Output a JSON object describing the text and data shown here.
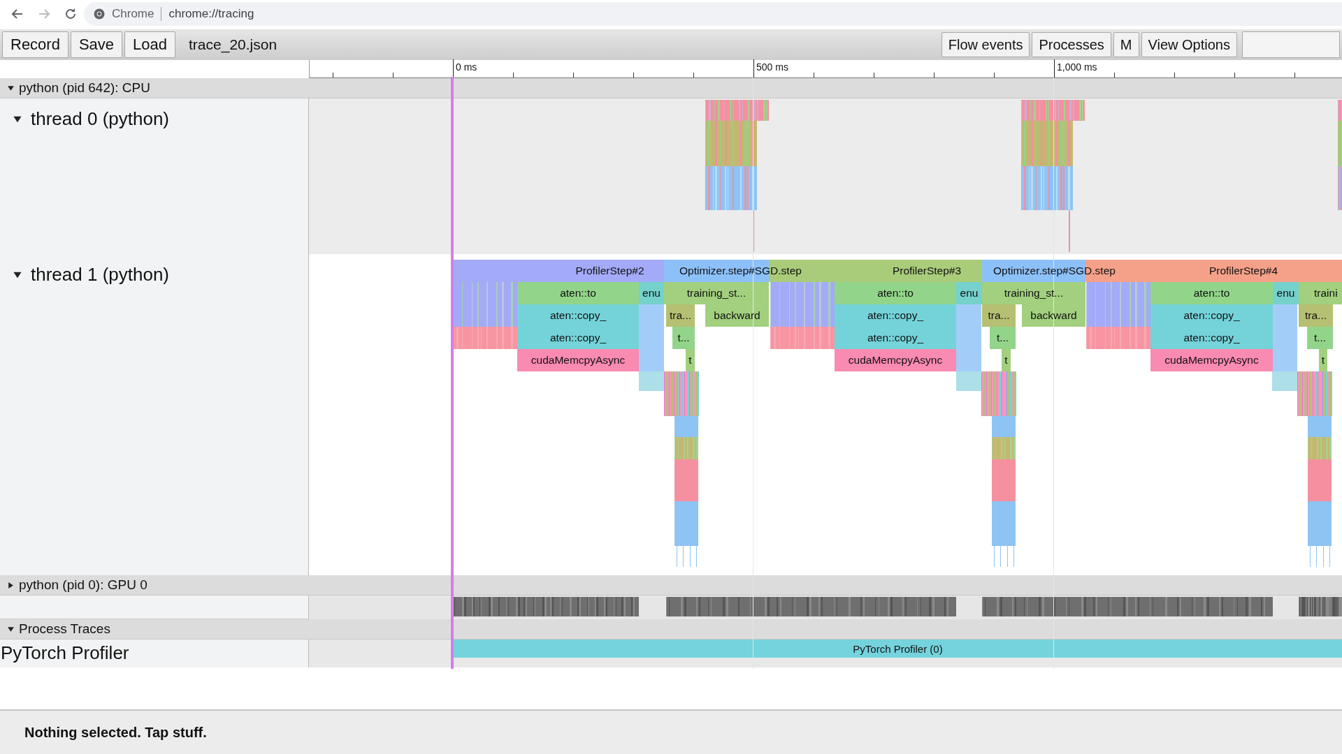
{
  "browser": {
    "app_label": "Chrome",
    "url": "chrome://tracing"
  },
  "toolbar": {
    "left_buttons": [
      "Record",
      "Save",
      "Load"
    ],
    "filename": "trace_20.json",
    "right_buttons": [
      "Flow events",
      "Processes",
      "M",
      "View Options"
    ]
  },
  "ruler": {
    "ticks": [
      {
        "label": "0 ms"
      },
      {
        "label": "500 ms"
      },
      {
        "label": "1,000 ms"
      }
    ]
  },
  "processes": [
    {
      "title": "python (pid 642): CPU",
      "expanded": true,
      "threads": [
        {
          "name": "thread 0 (python)",
          "expanded": true,
          "kind": "clusters"
        },
        {
          "name": "thread 1 (python)",
          "expanded": true,
          "kind": "flame",
          "rows": [
            {
              "slices": [
                {
                  "label": "ProfilerStep#2",
                  "color": "#a3aaf8"
                },
                {
                  "label": "Optimizer.step#SGD.step",
                  "color": "#8cc0f8"
                },
                {
                  "label": "ProfilerStep#3",
                  "color": "#a9cc7a"
                },
                {
                  "label": "Optimizer.step#SGD.step",
                  "color": "#8cc0f8"
                },
                {
                  "label": "ProfilerStep#4",
                  "color": "#f5a189"
                }
              ]
            },
            {
              "slices": [
                {
                  "label": "aten::to",
                  "color": "#92d58a"
                },
                {
                  "label": "enu",
                  "color": "#74d1cc"
                },
                {
                  "label": "training_st...",
                  "color": "#a2d07e"
                },
                {
                  "label": "aten::to",
                  "color": "#92d58a"
                },
                {
                  "label": "enu",
                  "color": "#74d1cc"
                },
                {
                  "label": "training_st...",
                  "color": "#a2d07e"
                },
                {
                  "label": "aten::to",
                  "color": "#92d58a"
                },
                {
                  "label": "enu",
                  "color": "#74d1cc"
                },
                {
                  "label": "traini",
                  "color": "#a2d07e"
                }
              ]
            },
            {
              "slices": [
                {
                  "label": "aten::copy_",
                  "color": "#74d3d9"
                },
                {
                  "label": "tra...",
                  "color": "#b6c072"
                },
                {
                  "label": "backward",
                  "color": "#a2d07e"
                },
                {
                  "label": "aten::copy_",
                  "color": "#74d3d9"
                },
                {
                  "label": "tra...",
                  "color": "#b6c072"
                },
                {
                  "label": "backward",
                  "color": "#a2d07e"
                },
                {
                  "label": "aten::copy_",
                  "color": "#74d3d9"
                },
                {
                  "label": "tra...",
                  "color": "#b6c072"
                }
              ]
            },
            {
              "slices": [
                {
                  "label": "aten::copy_",
                  "color": "#74d3d9"
                },
                {
                  "label": "t...",
                  "color": "#92d58a"
                },
                {
                  "label": "aten::copy_",
                  "color": "#74d3d9"
                },
                {
                  "label": "t...",
                  "color": "#92d58a"
                },
                {
                  "label": "aten::copy_",
                  "color": "#74d3d9"
                },
                {
                  "label": "t...",
                  "color": "#92d58a"
                }
              ]
            },
            {
              "slices": [
                {
                  "label": "cudaMemcpyAsync",
                  "color": "#f98ab2"
                },
                {
                  "label": "t",
                  "color": "#a2d07e"
                },
                {
                  "label": "cudaMemcpyAsync",
                  "color": "#f98ab2"
                },
                {
                  "label": "t",
                  "color": "#a2d07e"
                },
                {
                  "label": "cudaMemcpyAsync",
                  "color": "#f98ab2"
                },
                {
                  "label": "t",
                  "color": "#a2d07e"
                }
              ]
            }
          ]
        }
      ]
    },
    {
      "title": "python (pid 0): GPU 0",
      "expanded": false,
      "threads": [
        {
          "kind": "gpu"
        }
      ]
    },
    {
      "title": "Process Traces",
      "expanded": true,
      "threads": [
        {
          "name": "PyTorch Profiler",
          "kind": "profiler",
          "slices": [
            {
              "label": "PyTorch Profiler (0)",
              "color": "#74d3dc"
            }
          ]
        }
      ]
    }
  ],
  "status": "Nothing selected. Tap stuff."
}
